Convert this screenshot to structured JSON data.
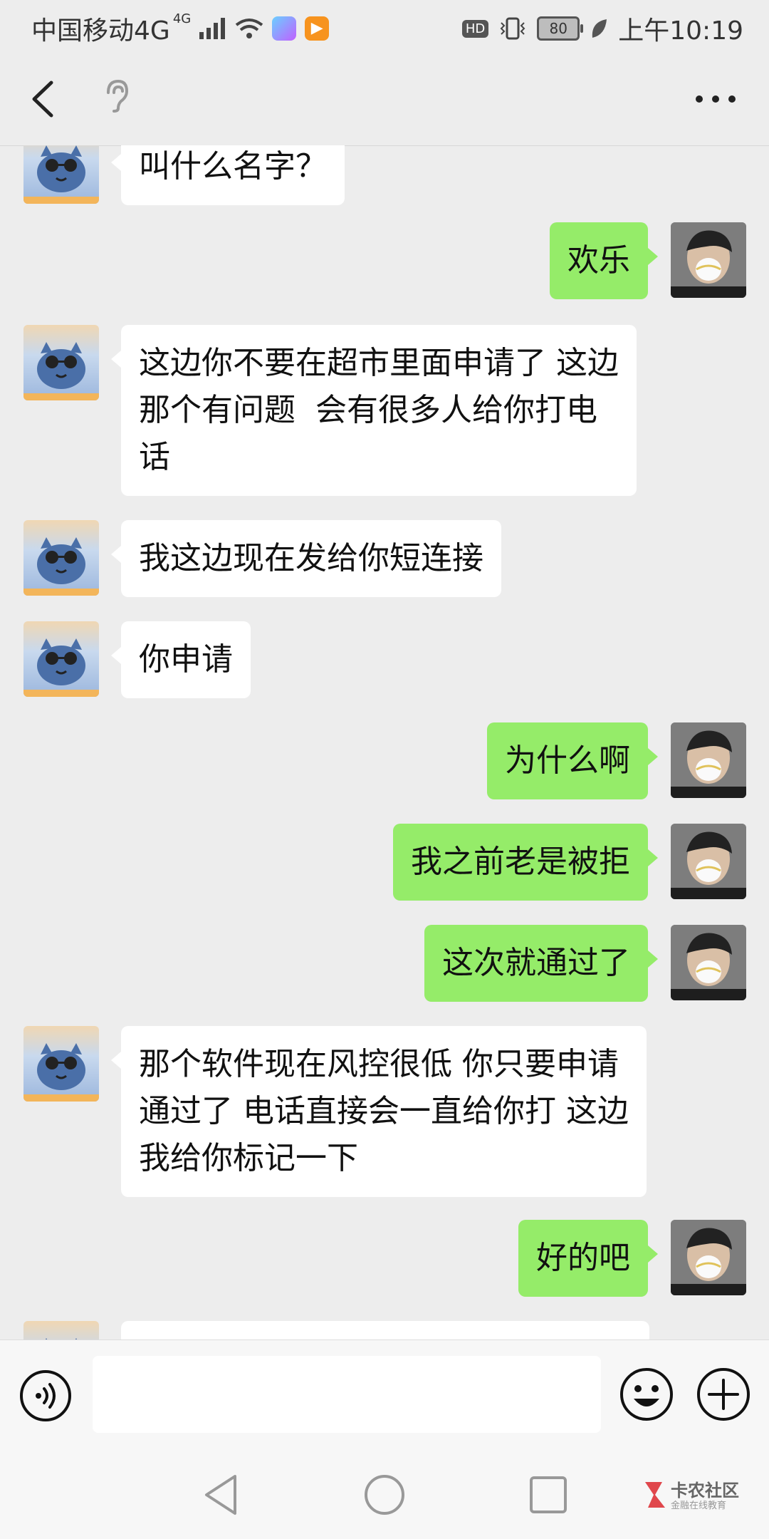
{
  "status_bar": {
    "carrier": "中国移动4G",
    "network_superscript": "4G",
    "hd_label": "HD",
    "battery": "80",
    "time": "上午10:19"
  },
  "header": {
    "title": "",
    "back_icon": "chevron-left-icon",
    "voice_mode_icon": "ear-icon",
    "more_icon": "more-horizontal-icon"
  },
  "messages": [
    {
      "side": "in",
      "text": "叫什么名字？"
    },
    {
      "side": "out",
      "text": "欢乐"
    },
    {
      "side": "in",
      "text": "这边你不要在超市里面申请了 这边\n那个有问题  会有很多人给你打电\n话"
    },
    {
      "side": "in",
      "text": "我这边现在发给你短连接"
    },
    {
      "side": "in",
      "text": "你申请"
    },
    {
      "side": "out",
      "text": "为什么啊"
    },
    {
      "side": "out",
      "text": "我之前老是被拒"
    },
    {
      "side": "out",
      "text": "这次就通过了"
    },
    {
      "side": "in",
      "text": "那个软件现在风控很低 你只要申请\n通过了 电话直接会一直给你打 这边\n我给你标记一下"
    },
    {
      "side": "out",
      "text": "好的吧"
    },
    {
      "side": "in",
      "text": ""
    }
  ],
  "input_bar": {
    "voice_icon": "voice-input-icon",
    "value": "",
    "emoji_icon": "emoji-icon",
    "plus_icon": "plus-circle-icon"
  },
  "system_nav": {
    "back_icon": "triangle-back-icon",
    "home_icon": "circle-home-icon",
    "recent_icon": "square-recent-icon"
  },
  "watermark": {
    "name": "卡农社区",
    "sub": "金融在线教育"
  },
  "colors": {
    "background": "#ededed",
    "incoming_bubble": "#ffffff",
    "outgoing_bubble": "#95ec69"
  }
}
